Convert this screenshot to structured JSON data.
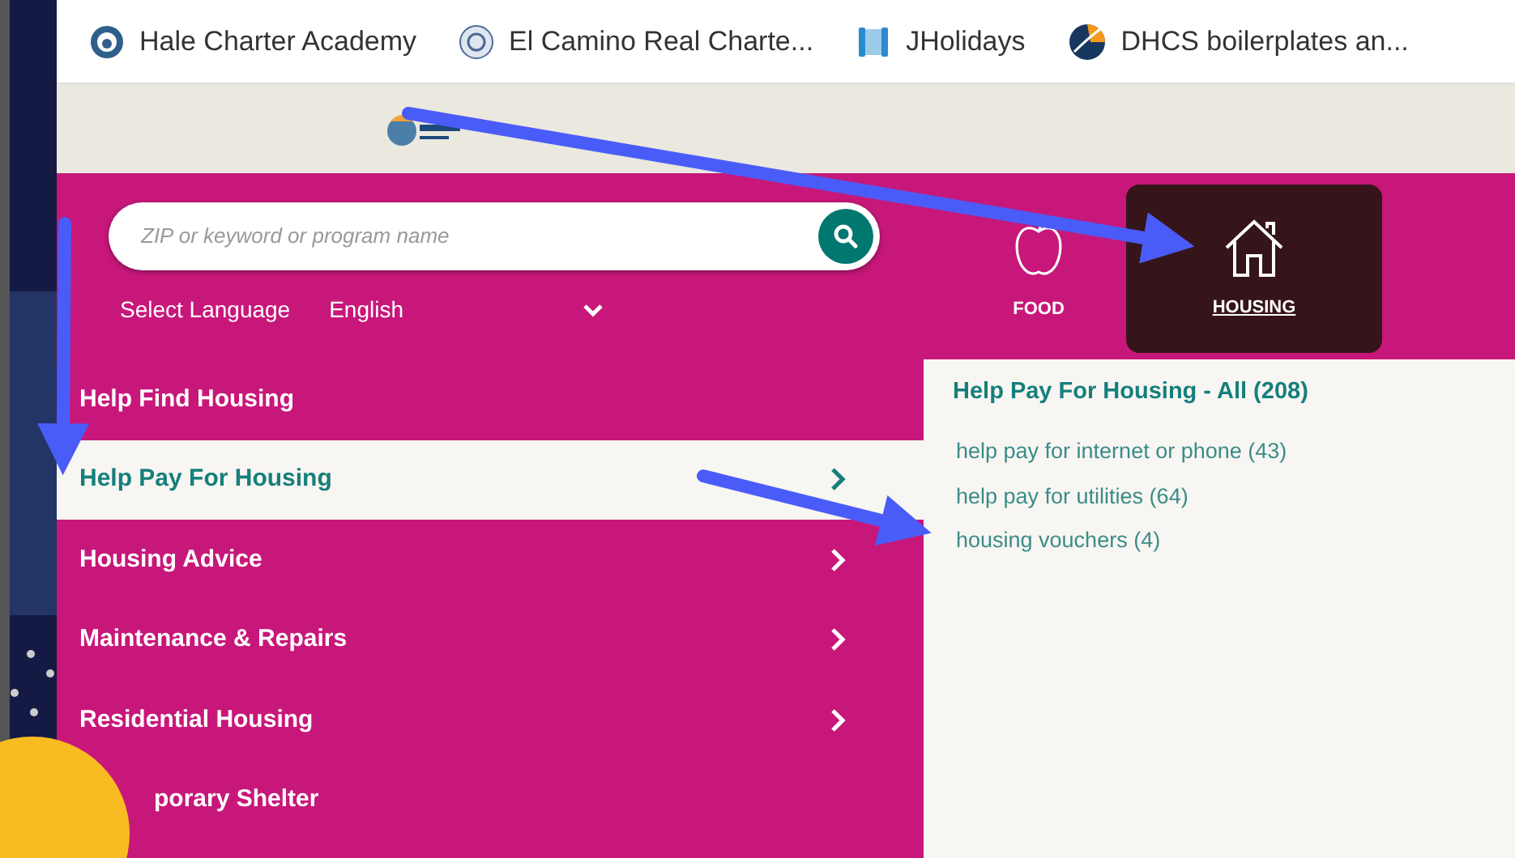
{
  "bookmarks": [
    {
      "title": "Hale Charter Academy"
    },
    {
      "title": "El Camino Real Charte..."
    },
    {
      "title": "JHolidays"
    },
    {
      "title": "DHCS  boilerplates an..."
    }
  ],
  "search": {
    "placeholder": "ZIP or keyword or program name"
  },
  "language": {
    "label": "Select Language",
    "value": "English"
  },
  "categories": [
    {
      "label": "FOOD",
      "selected": false
    },
    {
      "label": "HOUSING",
      "selected": true
    }
  ],
  "menu": [
    {
      "label": "Help Find Housing",
      "selected": false,
      "chevron": false
    },
    {
      "label": "Help Pay For Housing",
      "selected": true,
      "chevron": true
    },
    {
      "label": "Housing Advice",
      "selected": false,
      "chevron": true
    },
    {
      "label": "Maintenance & Repairs",
      "selected": false,
      "chevron": true
    },
    {
      "label": "Residential Housing",
      "selected": false,
      "chevron": true
    },
    {
      "label": "porary Shelter",
      "selected": false,
      "chevron": false
    }
  ],
  "panel": {
    "heading": "Help Pay For Housing - All (208)",
    "links": [
      "help pay for internet or phone (43)",
      "help pay for utilities (64)",
      "housing vouchers (4)"
    ]
  }
}
